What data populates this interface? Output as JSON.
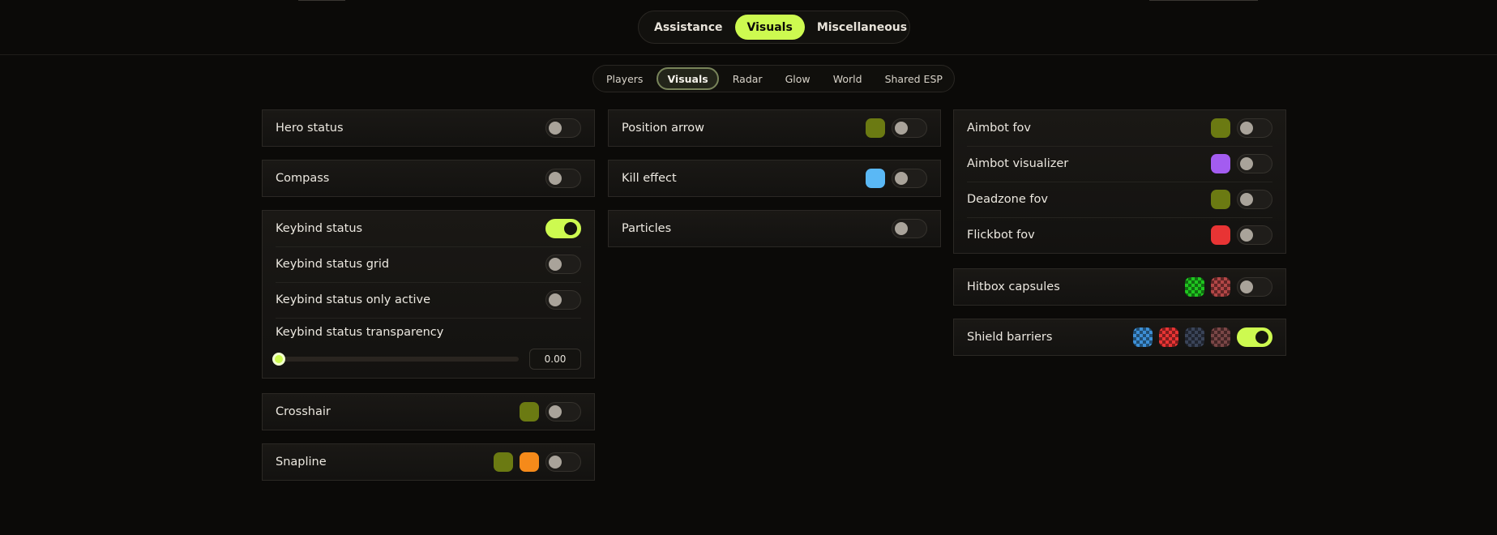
{
  "top_tabs": [
    {
      "label": "Assistance",
      "active": false
    },
    {
      "label": "Visuals",
      "active": true
    },
    {
      "label": "Miscellaneous",
      "active": false
    }
  ],
  "sub_tabs": [
    {
      "label": "Players",
      "active": false
    },
    {
      "label": "Visuals",
      "active": true
    },
    {
      "label": "Radar",
      "active": false
    },
    {
      "label": "Glow",
      "active": false
    },
    {
      "label": "World",
      "active": false
    },
    {
      "label": "Shared ESP",
      "active": false
    }
  ],
  "colors": {
    "accent": "#cdfa50",
    "olive": "#6b7a12",
    "sky": "#5ab8f5",
    "purple": "#a35cf0",
    "red": "#e83434",
    "orange": "#f58a1a",
    "green_checker": "#1fc61f",
    "red_checker": "#b24646",
    "blue_checker": "#3d8fd6",
    "dark_checker": "#3a4458",
    "brown_checker": "#7a4646"
  },
  "col1": {
    "hero_status": {
      "label": "Hero status",
      "on": false
    },
    "compass": {
      "label": "Compass",
      "on": false
    },
    "keybind": {
      "status": {
        "label": "Keybind status",
        "on": true
      },
      "grid": {
        "label": "Keybind status grid",
        "on": false
      },
      "only_active": {
        "label": "Keybind status only active",
        "on": false
      },
      "transparency": {
        "label": "Keybind status transparency",
        "value": "0.00",
        "fraction": 0
      }
    },
    "crosshair": {
      "label": "Crosshair",
      "on": false
    },
    "snapline": {
      "label": "Snapline",
      "on": false
    }
  },
  "col2": {
    "position_arrow": {
      "label": "Position arrow",
      "on": false
    },
    "kill_effect": {
      "label": "Kill effect",
      "on": false
    },
    "particles": {
      "label": "Particles",
      "on": false
    }
  },
  "col3": {
    "aimbot_fov": {
      "label": "Aimbot fov",
      "on": false
    },
    "aimbot_visualizer": {
      "label": "Aimbot visualizer",
      "on": false
    },
    "deadzone_fov": {
      "label": "Deadzone fov",
      "on": false
    },
    "flickbot_fov": {
      "label": "Flickbot fov",
      "on": false
    },
    "hitbox_capsules": {
      "label": "Hitbox capsules",
      "on": false
    },
    "shield_barriers": {
      "label": "Shield barriers",
      "on": true
    }
  }
}
